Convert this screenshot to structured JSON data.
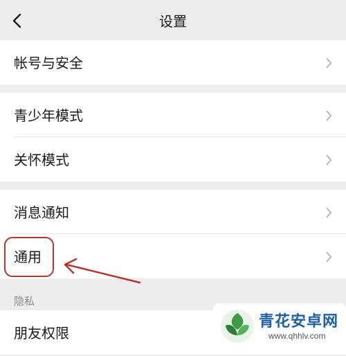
{
  "header": {
    "title": "设置",
    "back_icon": "chevron-left-icon"
  },
  "groups": [
    {
      "items": [
        {
          "label": "帐号与安全"
        }
      ]
    },
    {
      "items": [
        {
          "label": "青少年模式"
        },
        {
          "label": "关怀模式"
        }
      ]
    },
    {
      "items": [
        {
          "label": "消息通知"
        },
        {
          "label": "通用"
        }
      ]
    }
  ],
  "privacy": {
    "section_label": "隐私",
    "items": [
      {
        "label": "朋友权限"
      }
    ]
  },
  "annotation": {
    "color": "#b5352e",
    "highlighted_item": "通用"
  },
  "watermark": {
    "name": "青花安卓网",
    "url": "www.qhhlv.com"
  },
  "colors": {
    "background": "#ededed",
    "row": "#ffffff",
    "chevron": "#b2b2b2",
    "section_text": "#8a8a8a"
  }
}
